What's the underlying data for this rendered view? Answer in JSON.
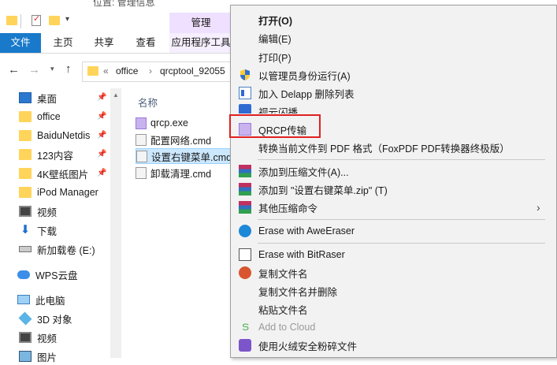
{
  "window": {
    "location_text": "位置: 管理信息"
  },
  "ribbon": {
    "manage_label": "管理",
    "tabs": [
      {
        "label": "文件"
      },
      {
        "label": "主页"
      },
      {
        "label": "共享"
      },
      {
        "label": "查看"
      },
      {
        "label": "应用程序工具"
      }
    ]
  },
  "address": {
    "overflow": "«",
    "crumbs": [
      "office",
      "qrcptool_92055"
    ]
  },
  "nav": {
    "items": [
      {
        "label": "桌面",
        "icon": "desktop-icon",
        "pinned": true
      },
      {
        "label": "office",
        "icon": "folder-icon",
        "pinned": true
      },
      {
        "label": "BaiduNetdis",
        "icon": "folder-icon",
        "pinned": true
      },
      {
        "label": "123内容",
        "icon": "folder-icon",
        "pinned": true
      },
      {
        "label": "4K壁纸图片",
        "icon": "folder-icon",
        "pinned": true
      },
      {
        "label": "iPod Manager",
        "icon": "folder-icon",
        "pinned": false
      },
      {
        "label": "视频",
        "icon": "video-icon",
        "pinned": false
      },
      {
        "label": "下载",
        "icon": "download-icon",
        "pinned": false
      },
      {
        "label": "新加载卷 (E:)",
        "icon": "drive-icon",
        "pinned": false
      },
      {
        "label": "WPS云盘",
        "icon": "cloud-icon",
        "pinned": false
      },
      {
        "label": "此电脑",
        "icon": "computer-icon",
        "pinned": false
      },
      {
        "label": "3D 对象",
        "icon": "3d-objects-icon",
        "pinned": false
      },
      {
        "label": "视频",
        "icon": "video-icon",
        "pinned": false
      },
      {
        "label": "图片",
        "icon": "pictures-icon",
        "pinned": false
      }
    ]
  },
  "files": {
    "column_name": "名称",
    "items": [
      {
        "name": "qrcp.exe"
      },
      {
        "name": "配置网络.cmd"
      },
      {
        "name": "设置右键菜单.cmd"
      },
      {
        "name": "卸载清理.cmd"
      }
    ]
  },
  "context_menu": {
    "items": [
      {
        "label": "打开(O)",
        "icon": ""
      },
      {
        "label": "编辑(E)",
        "icon": ""
      },
      {
        "label": "打印(P)",
        "icon": ""
      },
      {
        "label": "以管理员身份运行(A)",
        "icon": "shield-icon"
      },
      {
        "label": "加入 Delapp 删除列表",
        "icon": "delapp-icon"
      },
      {
        "label": "视云闪播",
        "icon": "player-icon"
      },
      {
        "label": "QRCP传输",
        "icon": "qrcp-icon"
      },
      {
        "label": "转换当前文件到 PDF 格式（FoxPDF PDF转换器终极版）",
        "icon": ""
      },
      {
        "label": "添加到压缩文件(A)...",
        "icon": "winrar-icon"
      },
      {
        "label": "添加到 \"设置右键菜单.zip\" (T)",
        "icon": "winrar-icon"
      },
      {
        "label": "其他压缩命令",
        "icon": "winrar-icon"
      },
      {
        "label": "Erase with AweEraser",
        "icon": "aweeraser-icon"
      },
      {
        "label": "Erase with BitRaser",
        "icon": "bitraser-icon"
      },
      {
        "label": "复制文件名",
        "icon": "copy-name-icon"
      },
      {
        "label": "复制文件名并删除",
        "icon": ""
      },
      {
        "label": "粘贴文件名",
        "icon": ""
      },
      {
        "label": "Add to Cloud",
        "icon": "cloud-sync-icon"
      },
      {
        "label": "使用火绒安全粉碎文件",
        "icon": "shredder-icon"
      }
    ]
  },
  "colors": {
    "accent": "#1979ca",
    "highlight_box": "#e02020",
    "menu_bg": "#f2f2f2"
  }
}
